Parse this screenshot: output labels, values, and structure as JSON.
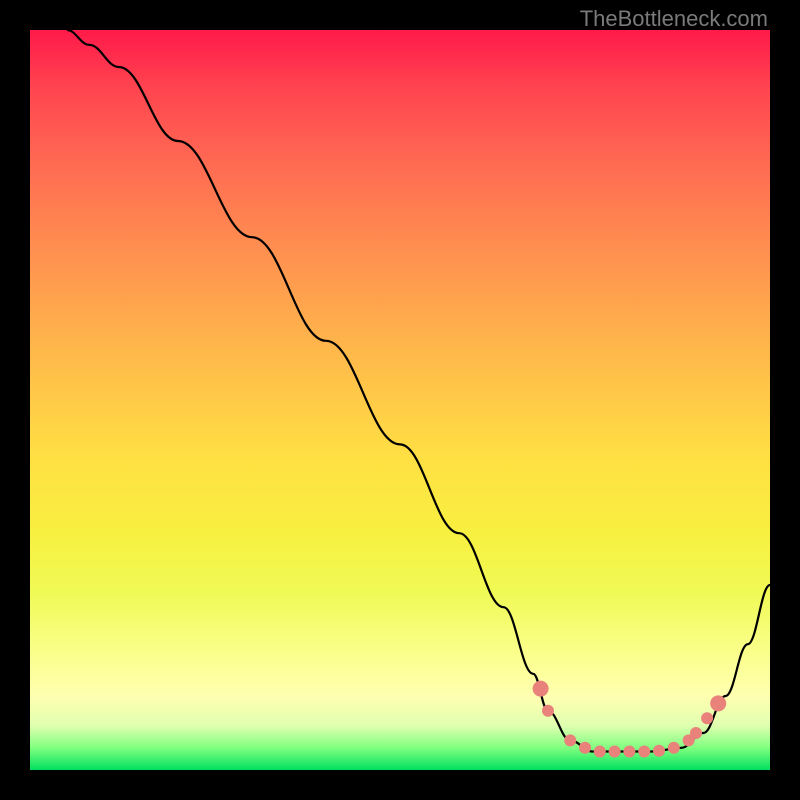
{
  "attribution": "TheBottleneck.com",
  "chart_data": {
    "type": "line",
    "title": "",
    "xlabel": "",
    "ylabel": "",
    "ylim": [
      0,
      100
    ],
    "xlim": [
      0,
      100
    ],
    "series": [
      {
        "name": "bottleneck-curve",
        "x": [
          5,
          8,
          12,
          20,
          30,
          40,
          50,
          58,
          64,
          68,
          70,
          73,
          76,
          80,
          84,
          88,
          91,
          94,
          97,
          100
        ],
        "values": [
          100,
          98,
          95,
          85,
          72,
          58,
          44,
          32,
          22,
          13,
          8,
          4,
          2.5,
          2.5,
          2.5,
          3,
          5,
          10,
          17,
          25
        ]
      }
    ],
    "markers": {
      "name": "highlighted-points",
      "x": [
        69,
        70,
        73,
        75,
        77,
        79,
        81,
        83,
        85,
        87,
        89,
        90,
        91.5,
        93
      ],
      "values": [
        11,
        8,
        4,
        3,
        2.5,
        2.5,
        2.5,
        2.5,
        2.6,
        3,
        4,
        5,
        7,
        9
      ]
    }
  }
}
